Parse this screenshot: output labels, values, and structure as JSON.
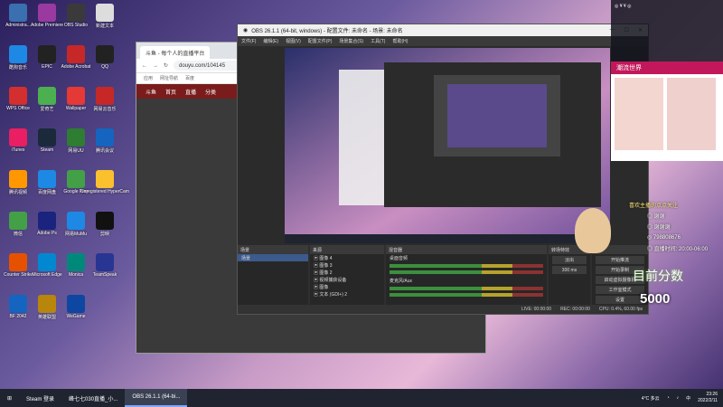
{
  "desktop_icons": [
    {
      "label": "Administra...",
      "color": "#3a6fb0"
    },
    {
      "label": "Adobe Premiere",
      "color": "#9a3aa0"
    },
    {
      "label": "OBS Studio",
      "color": "#3a3a3a"
    },
    {
      "label": "新建文本",
      "color": "#ddd"
    },
    {
      "label": "酷狗音乐",
      "color": "#1e88e5"
    },
    {
      "label": "EPIC",
      "color": "#222"
    },
    {
      "label": "Adobe Acrobat",
      "color": "#c62828"
    },
    {
      "label": "QQ",
      "color": "#222"
    },
    {
      "label": "WPS Office",
      "color": "#d32f2f"
    },
    {
      "label": "爱奇艺",
      "color": "#4caf50"
    },
    {
      "label": "Wallpaper",
      "color": "#e53935"
    },
    {
      "label": "网易云音乐",
      "color": "#c62828"
    },
    {
      "label": "iTunes",
      "color": "#e91e63"
    },
    {
      "label": "Steam",
      "color": "#1a2a3a"
    },
    {
      "label": "网易UU",
      "color": "#2e7d32"
    },
    {
      "label": "腾讯会议",
      "color": "#1565c0"
    },
    {
      "label": "腾讯视频",
      "color": "#ff9800"
    },
    {
      "label": "百度网盘",
      "color": "#1e88e5"
    },
    {
      "label": "Google Play",
      "color": "#43a047"
    },
    {
      "label": "Unregistered HyperCam",
      "color": "#fbc02d"
    },
    {
      "label": "微信",
      "color": "#43a047"
    },
    {
      "label": "Adobe Ps",
      "color": "#1a237e"
    },
    {
      "label": "网易MuMu",
      "color": "#1e88e5"
    },
    {
      "label": "剪映",
      "color": "#111"
    },
    {
      "label": "Counter Strike",
      "color": "#e65100"
    },
    {
      "label": "Microsoft Edge",
      "color": "#0288d1"
    },
    {
      "label": "Monica",
      "color": "#00897b"
    },
    {
      "label": "TeamSpeak",
      "color": "#283593"
    },
    {
      "label": "BF 2042",
      "color": "#1565c0"
    },
    {
      "label": "英雄联盟",
      "color": "#b8860b"
    },
    {
      "label": "WeGame",
      "color": "#0d47a1"
    }
  ],
  "browser": {
    "tab_label": "斗鱼 - 每个人的直播平台",
    "url": "douyu.com/104145",
    "bookmarks": [
      "应用",
      "网址导航",
      "百度"
    ],
    "site_nav": [
      "斗鱼",
      "首页",
      "直播",
      "分类"
    ]
  },
  "obs": {
    "title": "OBS 26.1.1 (64-bit, windows) - 配置文件: 未命名 - 场景: 未命名",
    "menu": [
      "文件(F)",
      "编辑(E)",
      "视图(V)",
      "配置文件(P)",
      "场景集合(S)",
      "工具(T)",
      "帮助(H)"
    ],
    "scenes_header": "场景",
    "sources_header": "来源",
    "mixer_header": "混音器",
    "transitions_header": "转场特效",
    "controls_header": "控件",
    "scene_items": [
      "场景"
    ],
    "source_items": [
      "图像 4",
      "图像 3",
      "图像 2",
      "视频捕获设备",
      "图像",
      "文本 (GDI+) 2"
    ],
    "mixer_tracks": [
      "桌面音频",
      "麦克风/Aux"
    ],
    "transition_select": "淡出",
    "duration": "300 ms",
    "control_buttons": [
      "开始推流",
      "开始录制",
      "启动虚拟摄像机",
      "工作室模式",
      "设置",
      "退出"
    ],
    "status": {
      "live": "LIVE: 00:00:00",
      "rec": "REC: 00:00:00",
      "cpu": "CPU: 0.4%, 60.00 fps"
    }
  },
  "stream_overlay": {
    "top_text": "◎ ¥ ¥ ◎",
    "shop_banner": "潮流世界",
    "follow_banner": "喜欢主播的点点关注",
    "follower_lines": [
      "◎ 谢谢",
      "◎ 谢谢谢",
      "◎ 798808676",
      "◎ 直播时间: 20:00-06:00"
    ],
    "fans_label": "目前分数",
    "fans_count": "5000"
  },
  "taskbar": {
    "items": [
      "Steam 登录",
      "峰七七030直播_小...",
      "OBS 26.1.1 (64-bi..."
    ],
    "weather": "4°C 多云",
    "lang": "中",
    "time": "23:26",
    "date": "2022/2/11"
  }
}
